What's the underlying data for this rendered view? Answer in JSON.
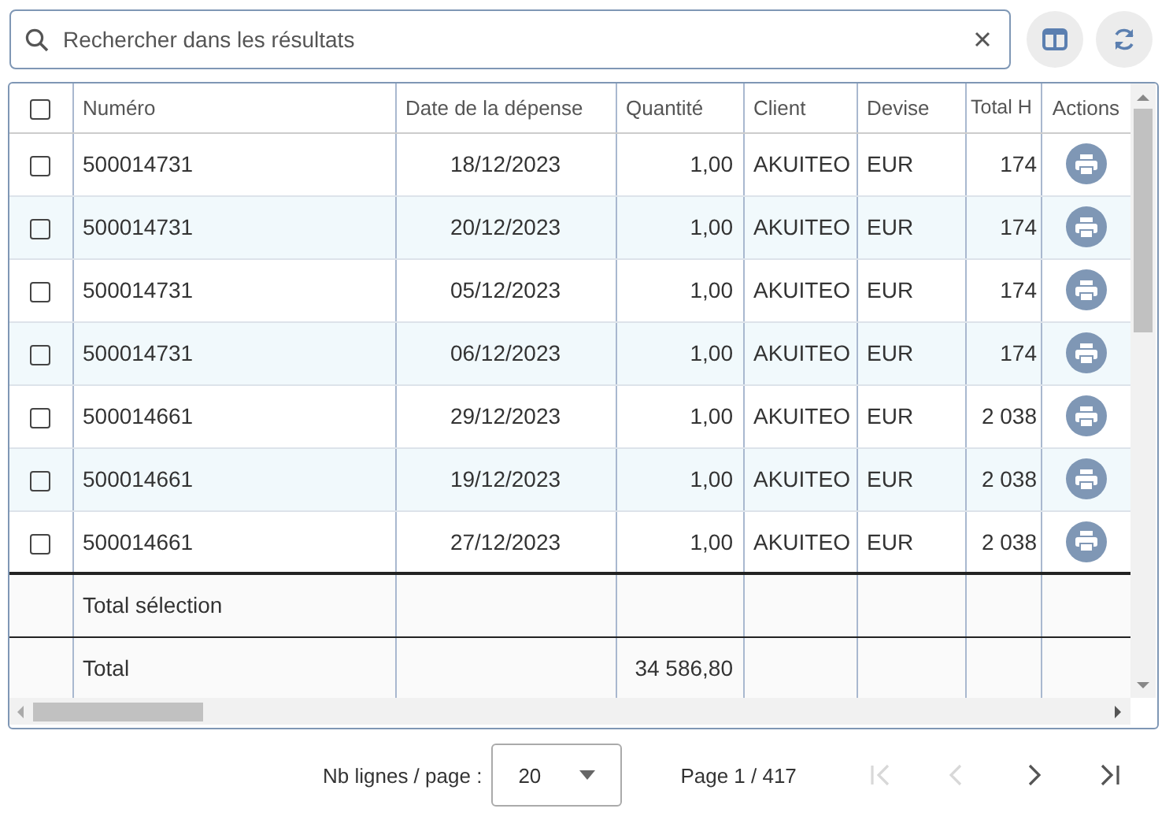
{
  "search": {
    "placeholder": "Rechercher dans les résultats"
  },
  "table": {
    "select_all": {
      "checked": false
    },
    "columns": [
      "Numéro",
      "Date de la dépense",
      "Quantité",
      "Client",
      "Devise",
      "Total H",
      "Actions"
    ],
    "rows": [
      {
        "checked": false,
        "cells": [
          "500014731",
          "18/12/2023",
          "1,00",
          "AKUITEO",
          "EUR",
          "174"
        ]
      },
      {
        "checked": false,
        "cells": [
          "500014731",
          "20/12/2023",
          "1,00",
          "AKUITEO",
          "EUR",
          "174"
        ]
      },
      {
        "checked": false,
        "cells": [
          "500014731",
          "05/12/2023",
          "1,00",
          "AKUITEO",
          "EUR",
          "174"
        ]
      },
      {
        "checked": false,
        "cells": [
          "500014731",
          "06/12/2023",
          "1,00",
          "AKUITEO",
          "EUR",
          "174"
        ]
      },
      {
        "checked": false,
        "cells": [
          "500014661",
          "29/12/2023",
          "1,00",
          "AKUITEO",
          "EUR",
          "2 038"
        ]
      },
      {
        "checked": false,
        "cells": [
          "500014661",
          "19/12/2023",
          "1,00",
          "AKUITEO",
          "EUR",
          "2 038"
        ]
      },
      {
        "checked": false,
        "cells": [
          "500014661",
          "27/12/2023",
          "1,00",
          "AKUITEO",
          "EUR",
          "2 038"
        ]
      }
    ],
    "totals": [
      {
        "label": "Total sélection"
      },
      {
        "label": "Total",
        "quantity": "34 586,80"
      }
    ]
  },
  "pagination": {
    "rows_label": "Nb lignes / page :",
    "page_size": "20",
    "page_info": "Page 1 / 417",
    "buttons": [
      {
        "kind": "first",
        "disabled": true
      },
      {
        "kind": "prev",
        "disabled": true
      },
      {
        "kind": "next",
        "disabled": false
      },
      {
        "kind": "last",
        "disabled": false
      }
    ]
  }
}
